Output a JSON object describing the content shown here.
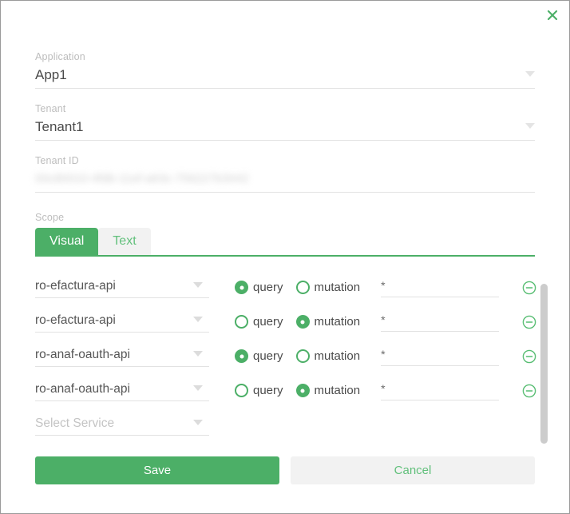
{
  "colors": {
    "accent_green": "#4caf67",
    "tab_inactive_bg": "#f2f2f2",
    "label_gray": "#bdbdbd",
    "underline_gray": "#e2e2e2",
    "scrollbar_gray": "#cccccc"
  },
  "dialog": {
    "close_icon": "close-icon"
  },
  "fields": {
    "application": {
      "label": "Application",
      "value": "App1",
      "caret_icon": "chevron-down-icon"
    },
    "tenant": {
      "label": "Tenant",
      "value": "Tenant1",
      "caret_icon": "chevron-down-icon"
    },
    "tenant_id": {
      "label": "Tenant ID",
      "value": "00c80010-4fdb-11ef-a63c-756227b3442",
      "redacted": true
    }
  },
  "scope": {
    "label": "Scope",
    "tabs": [
      {
        "label": "Visual",
        "active": true
      },
      {
        "label": "Text",
        "active": false
      }
    ],
    "radio_options": {
      "query": "query",
      "mutation": "mutation"
    },
    "remove_icon": "circle-minus-icon",
    "rows": [
      {
        "service": "ro-efactura-api",
        "operation": "query",
        "value": "*"
      },
      {
        "service": "ro-efactura-api",
        "operation": "mutation",
        "value": "*"
      },
      {
        "service": "ro-anaf-oauth-api",
        "operation": "query",
        "value": "*"
      },
      {
        "service": "ro-anaf-oauth-api",
        "operation": "mutation",
        "value": "*"
      }
    ],
    "new_row_placeholder": "Select Service"
  },
  "footer": {
    "save_label": "Save",
    "cancel_label": "Cancel"
  }
}
